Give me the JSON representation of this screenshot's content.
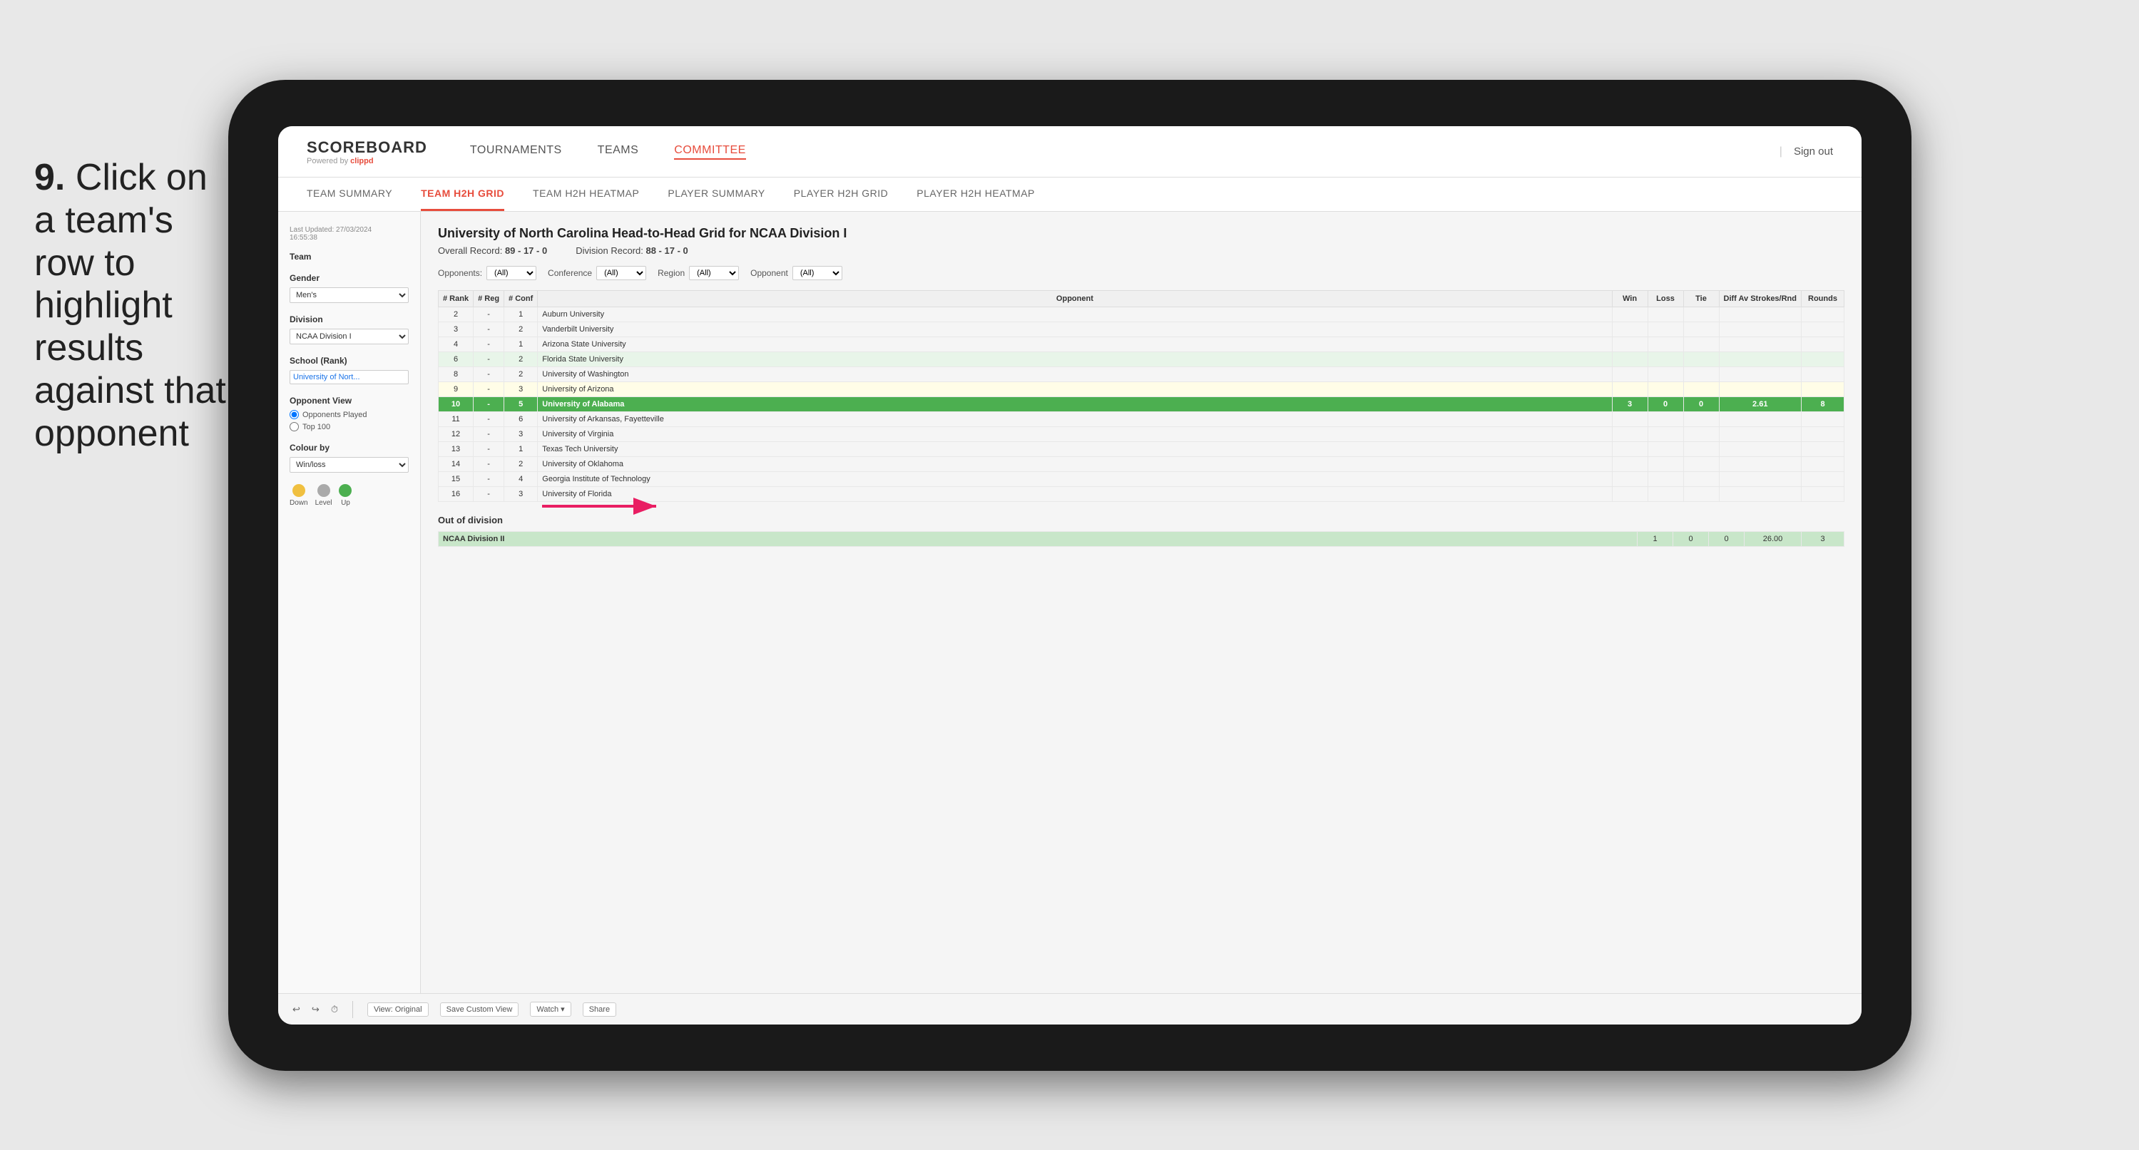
{
  "instruction": {
    "step": "9.",
    "text": "Click on a team's row to highlight results against that opponent"
  },
  "nav": {
    "logo": "SCOREBOARD",
    "powered_by": "Powered by",
    "clippd": "clippd",
    "items": [
      {
        "label": "TOURNAMENTS",
        "active": false
      },
      {
        "label": "TEAMS",
        "active": false
      },
      {
        "label": "COMMITTEE",
        "active": true
      }
    ],
    "sign_out": "Sign out"
  },
  "sub_nav": {
    "items": [
      {
        "label": "TEAM SUMMARY",
        "active": false
      },
      {
        "label": "TEAM H2H GRID",
        "active": true
      },
      {
        "label": "TEAM H2H HEATMAP",
        "active": false
      },
      {
        "label": "PLAYER SUMMARY",
        "active": false
      },
      {
        "label": "PLAYER H2H GRID",
        "active": false
      },
      {
        "label": "PLAYER H2H HEATMAP",
        "active": false
      }
    ]
  },
  "sidebar": {
    "last_updated_label": "Last Updated: 27/03/2024",
    "last_updated_time": "16:55:38",
    "team_label": "Team",
    "gender_label": "Gender",
    "gender_value": "Men's",
    "division_label": "Division",
    "division_value": "NCAA Division I",
    "school_label": "School (Rank)",
    "school_value": "University of Nort...",
    "opponent_view_label": "Opponent View",
    "radio_opponents": "Opponents Played",
    "radio_top100": "Top 100",
    "colour_by_label": "Colour by",
    "colour_by_value": "Win/loss",
    "legend": [
      {
        "label": "Down",
        "color": "yellow"
      },
      {
        "label": "Level",
        "color": "gray"
      },
      {
        "label": "Up",
        "color": "green"
      }
    ]
  },
  "grid": {
    "title": "University of North Carolina Head-to-Head Grid for NCAA Division I",
    "overall_record_label": "Overall Record:",
    "overall_record": "89 - 17 - 0",
    "division_record_label": "Division Record:",
    "division_record": "88 - 17 - 0",
    "filters": {
      "opponents_label": "Opponents:",
      "opponents_value": "(All)",
      "conference_label": "Conference",
      "conference_value": "(All)",
      "region_label": "Region",
      "region_value": "(All)",
      "opponent_label": "Opponent",
      "opponent_value": "(All)"
    },
    "columns": {
      "rank": "# Rank",
      "reg": "# Reg",
      "conf": "# Conf",
      "opponent": "Opponent",
      "win": "Win",
      "loss": "Loss",
      "tie": "Tie",
      "diff": "Diff Av Strokes/Rnd",
      "rounds": "Rounds"
    },
    "rows": [
      {
        "rank": "2",
        "reg": "-",
        "conf": "1",
        "opponent": "Auburn University",
        "win": "",
        "loss": "",
        "tie": "",
        "diff": "",
        "rounds": "",
        "style": "normal"
      },
      {
        "rank": "3",
        "reg": "-",
        "conf": "2",
        "opponent": "Vanderbilt University",
        "win": "",
        "loss": "",
        "tie": "",
        "diff": "",
        "rounds": "",
        "style": "normal"
      },
      {
        "rank": "4",
        "reg": "-",
        "conf": "1",
        "opponent": "Arizona State University",
        "win": "",
        "loss": "",
        "tie": "",
        "diff": "",
        "rounds": "",
        "style": "normal"
      },
      {
        "rank": "6",
        "reg": "-",
        "conf": "2",
        "opponent": "Florida State University",
        "win": "",
        "loss": "",
        "tie": "",
        "diff": "",
        "rounds": "",
        "style": "light-green"
      },
      {
        "rank": "8",
        "reg": "-",
        "conf": "2",
        "opponent": "University of Washington",
        "win": "",
        "loss": "",
        "tie": "",
        "diff": "",
        "rounds": "",
        "style": "normal"
      },
      {
        "rank": "9",
        "reg": "-",
        "conf": "3",
        "opponent": "University of Arizona",
        "win": "",
        "loss": "",
        "tie": "",
        "diff": "",
        "rounds": "",
        "style": "light-yellow"
      },
      {
        "rank": "10",
        "reg": "-",
        "conf": "5",
        "opponent": "University of Alabama",
        "win": "3",
        "loss": "0",
        "tie": "0",
        "diff": "2.61",
        "rounds": "8",
        "style": "highlighted"
      },
      {
        "rank": "11",
        "reg": "-",
        "conf": "6",
        "opponent": "University of Arkansas, Fayetteville",
        "win": "",
        "loss": "",
        "tie": "",
        "diff": "",
        "rounds": "",
        "style": "normal"
      },
      {
        "rank": "12",
        "reg": "-",
        "conf": "3",
        "opponent": "University of Virginia",
        "win": "",
        "loss": "",
        "tie": "",
        "diff": "",
        "rounds": "",
        "style": "normal"
      },
      {
        "rank": "13",
        "reg": "-",
        "conf": "1",
        "opponent": "Texas Tech University",
        "win": "",
        "loss": "",
        "tie": "",
        "diff": "",
        "rounds": "",
        "style": "normal"
      },
      {
        "rank": "14",
        "reg": "-",
        "conf": "2",
        "opponent": "University of Oklahoma",
        "win": "",
        "loss": "",
        "tie": "",
        "diff": "",
        "rounds": "",
        "style": "normal"
      },
      {
        "rank": "15",
        "reg": "-",
        "conf": "4",
        "opponent": "Georgia Institute of Technology",
        "win": "",
        "loss": "",
        "tie": "",
        "diff": "",
        "rounds": "",
        "style": "normal"
      },
      {
        "rank": "16",
        "reg": "-",
        "conf": "3",
        "opponent": "University of Florida",
        "win": "",
        "loss": "",
        "tie": "",
        "diff": "",
        "rounds": "",
        "style": "normal"
      }
    ],
    "out_of_division_label": "Out of division",
    "out_of_division_row": {
      "label": "NCAA Division II",
      "win": "1",
      "loss": "0",
      "tie": "0",
      "diff": "26.00",
      "rounds": "3"
    }
  },
  "toolbar": {
    "undo": "↩",
    "redo": "↪",
    "history": "⏱",
    "view_original": "View: Original",
    "save_custom": "Save Custom View",
    "watch": "Watch ▾",
    "share": "Share"
  }
}
